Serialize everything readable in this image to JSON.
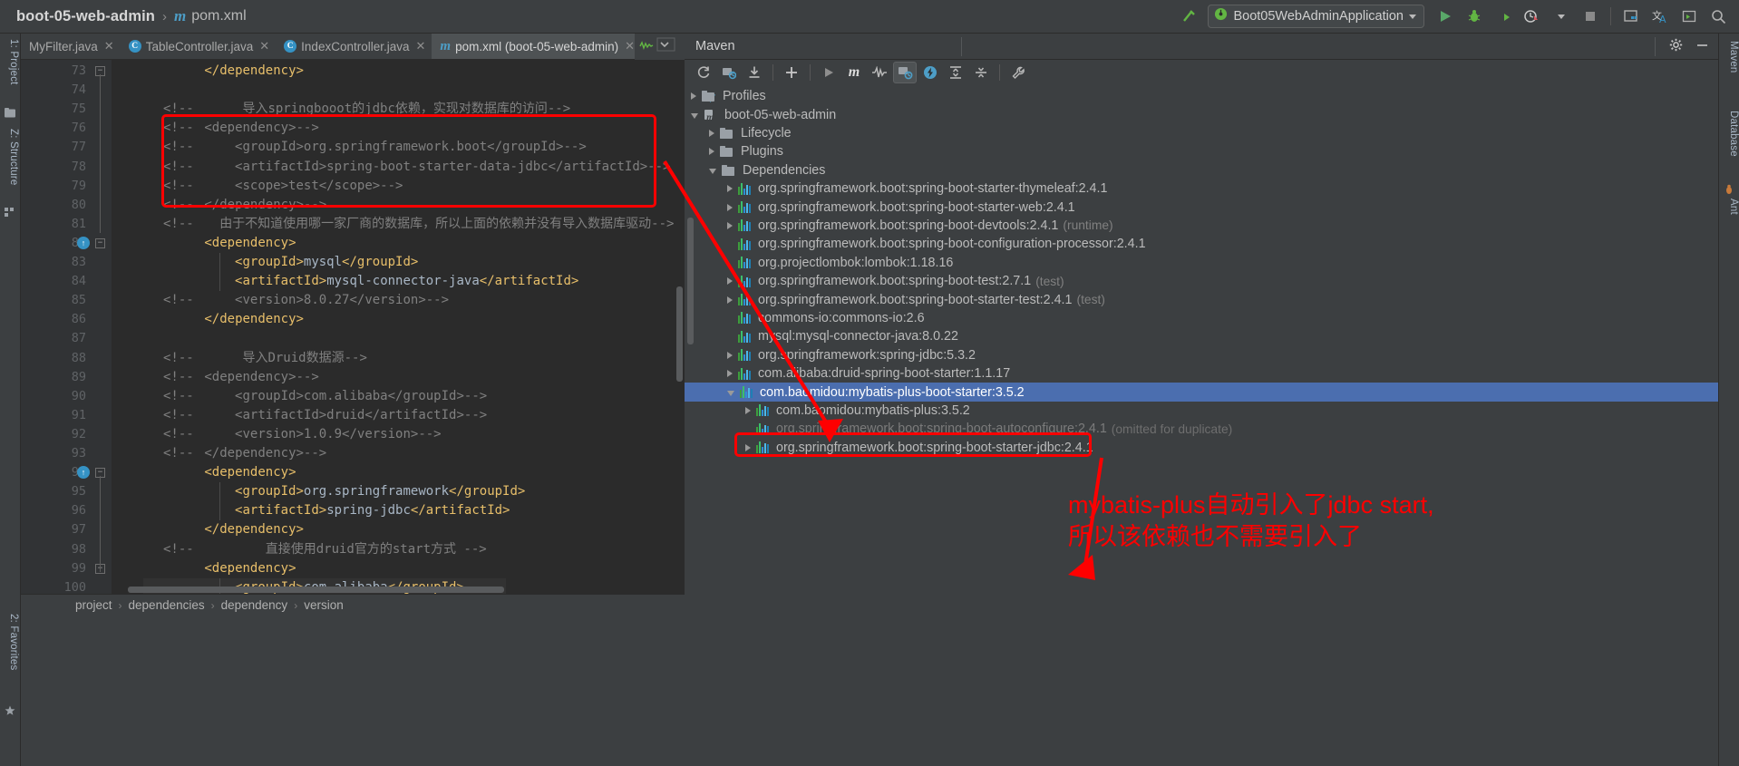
{
  "window": {
    "breadcrumb": {
      "project": "boot-05-web-admin",
      "separator": "›",
      "file": "pom.xml",
      "file_icon": "maven-m-icon"
    }
  },
  "toolbar": {
    "build_icon": "hammer-icon",
    "run_config": {
      "name": "Boot05WebAdminApplication",
      "icon": "spring-boot-icon",
      "dropdown_icon": "chevron-down-icon"
    },
    "buttons": [
      {
        "name": "run-button",
        "icon": "play-icon",
        "color": "#59a869"
      },
      {
        "name": "debug-button",
        "icon": "bug-icon",
        "color": "#62b543"
      },
      {
        "name": "run-with-coverage-button",
        "icon": "coverage-icon",
        "color": "#6cae4a"
      },
      {
        "name": "profiler-button",
        "icon": "profiler-icon",
        "color": "#cfcfcf"
      },
      {
        "name": "stop-button",
        "icon": "stop-square-icon",
        "color": "#8a8a8a"
      },
      {
        "name": "project-structure-button",
        "icon": "project-structure-icon",
        "color": "#b0b0b0"
      },
      {
        "name": "translate-button",
        "icon": "translate-icon",
        "color": "#3592c4"
      },
      {
        "name": "terminal-button",
        "icon": "terminal-icon",
        "color": "#b0b0b0"
      },
      {
        "name": "search-everywhere-button",
        "icon": "search-icon",
        "color": "#b0b0b0"
      }
    ]
  },
  "left_rail": [
    {
      "label": "1: Project",
      "icon": "project-icon"
    },
    {
      "label": "Z: Structure",
      "icon": "structure-icon"
    },
    {
      "label": "2: Favorites",
      "icon": "favorites-icon"
    }
  ],
  "right_rail": [
    {
      "label": "Maven",
      "icon": "maven-icon"
    },
    {
      "label": "Database",
      "icon": "database-icon"
    },
    {
      "label": "Ant",
      "icon": "ant-icon"
    }
  ],
  "editor_tabs": [
    {
      "label": "MyFilter.java",
      "icon": "java-class-icon",
      "active": false,
      "close_icon": "close-icon"
    },
    {
      "label": "TableController.java",
      "icon": "java-class-icon",
      "active": false,
      "close_icon": "close-icon"
    },
    {
      "label": "IndexController.java",
      "icon": "java-class-icon",
      "active": false,
      "close_icon": "close-icon"
    },
    {
      "label": "pom.xml (boot-05-web-admin)",
      "icon": "maven-m-icon",
      "active": true,
      "close_icon": "close-icon"
    }
  ],
  "editor": {
    "first_line": 73,
    "lines": [
      {
        "n": 73,
        "comment_marker": "",
        "indent": 8,
        "segments": [
          {
            "t": "</dependency>",
            "c": "tag"
          }
        ]
      },
      {
        "n": 74,
        "comment_marker": "",
        "indent": 0,
        "segments": []
      },
      {
        "n": 75,
        "comment_marker": "<!--",
        "indent": 13,
        "segments": [
          {
            "t": "导入springbooot的jdbc依赖，实现对数据库的访问-->",
            "c": "cmt"
          }
        ]
      },
      {
        "n": 76,
        "comment_marker": "<!--",
        "indent": 8,
        "segments": [
          {
            "t": "<dependency>-->",
            "c": "cmt"
          }
        ]
      },
      {
        "n": 77,
        "comment_marker": "<!--",
        "indent": 12,
        "segments": [
          {
            "t": "<groupId>org.springframework.boot</groupId>-->",
            "c": "cmt"
          }
        ]
      },
      {
        "n": 78,
        "comment_marker": "<!--",
        "indent": 12,
        "segments": [
          {
            "t": "<artifactId>spring-boot-starter-data-jdbc</artifactId>-->",
            "c": "cmt"
          }
        ]
      },
      {
        "n": 79,
        "comment_marker": "<!--",
        "indent": 12,
        "segments": [
          {
            "t": "<scope>test</scope>-->",
            "c": "cmt"
          }
        ]
      },
      {
        "n": 80,
        "comment_marker": "<!--",
        "indent": 8,
        "segments": [
          {
            "t": "</dependency>-->",
            "c": "cmt"
          }
        ]
      },
      {
        "n": 81,
        "comment_marker": "<!--",
        "indent": 10,
        "segments": [
          {
            "t": "由于不知道使用哪一家厂商的数据库，所以上面的依赖并没有导入数据库驱动-->",
            "c": "cmt"
          }
        ]
      },
      {
        "n": 82,
        "comment_marker": "",
        "indent": 8,
        "segments": [
          {
            "t": "<dependency>",
            "c": "tag"
          }
        ]
      },
      {
        "n": 83,
        "comment_marker": "",
        "indent": 12,
        "segments": [
          {
            "t": "<groupId>",
            "c": "tag"
          },
          {
            "t": "mysql",
            "c": "val"
          },
          {
            "t": "</groupId>",
            "c": "tag"
          }
        ]
      },
      {
        "n": 84,
        "comment_marker": "",
        "indent": 12,
        "segments": [
          {
            "t": "<artifactId>",
            "c": "tag"
          },
          {
            "t": "mysql-connector-java",
            "c": "val"
          },
          {
            "t": "</artifactId>",
            "c": "tag"
          }
        ]
      },
      {
        "n": 85,
        "comment_marker": "<!--",
        "indent": 12,
        "segments": [
          {
            "t": "<version>8.0.27</version>-->",
            "c": "cmt"
          }
        ]
      },
      {
        "n": 86,
        "comment_marker": "",
        "indent": 8,
        "segments": [
          {
            "t": "</dependency>",
            "c": "tag"
          }
        ]
      },
      {
        "n": 87,
        "comment_marker": "",
        "indent": 0,
        "segments": []
      },
      {
        "n": 88,
        "comment_marker": "<!--",
        "indent": 13,
        "segments": [
          {
            "t": "导入Druid数据源-->",
            "c": "cmt"
          }
        ]
      },
      {
        "n": 89,
        "comment_marker": "<!--",
        "indent": 8,
        "segments": [
          {
            "t": "<dependency>-->",
            "c": "cmt"
          }
        ]
      },
      {
        "n": 90,
        "comment_marker": "<!--",
        "indent": 12,
        "segments": [
          {
            "t": "<groupId>com.alibaba</groupId>-->",
            "c": "cmt"
          }
        ]
      },
      {
        "n": 91,
        "comment_marker": "<!--",
        "indent": 12,
        "segments": [
          {
            "t": "<artifactId>druid</artifactId>-->",
            "c": "cmt"
          }
        ]
      },
      {
        "n": 92,
        "comment_marker": "<!--",
        "indent": 12,
        "segments": [
          {
            "t": "<version>1.0.9</version>-->",
            "c": "cmt"
          }
        ]
      },
      {
        "n": 93,
        "comment_marker": "<!--",
        "indent": 8,
        "segments": [
          {
            "t": "</dependency>-->",
            "c": "cmt"
          }
        ]
      },
      {
        "n": 94,
        "comment_marker": "",
        "indent": 8,
        "segments": [
          {
            "t": "<dependency>",
            "c": "tag"
          }
        ]
      },
      {
        "n": 95,
        "comment_marker": "",
        "indent": 12,
        "segments": [
          {
            "t": "<groupId>",
            "c": "tag"
          },
          {
            "t": "org.springframework",
            "c": "val"
          },
          {
            "t": "</groupId>",
            "c": "tag"
          }
        ]
      },
      {
        "n": 96,
        "comment_marker": "",
        "indent": 12,
        "segments": [
          {
            "t": "<artifactId>",
            "c": "tag"
          },
          {
            "t": "spring-jdbc",
            "c": "val"
          },
          {
            "t": "</artifactId>",
            "c": "tag"
          }
        ]
      },
      {
        "n": 97,
        "comment_marker": "",
        "indent": 8,
        "segments": [
          {
            "t": "</dependency>",
            "c": "tag"
          }
        ]
      },
      {
        "n": 98,
        "comment_marker": "<!--",
        "indent": 16,
        "segments": [
          {
            "t": "直接使用druid官方的start方式 -->",
            "c": "cmt"
          }
        ]
      },
      {
        "n": 99,
        "comment_marker": "",
        "indent": 8,
        "segments": [
          {
            "t": "<dependency>",
            "c": "tag"
          }
        ]
      },
      {
        "n": 100,
        "comment_marker": "",
        "indent": 12,
        "segments": [
          {
            "t": "<groupId>",
            "c": "tag"
          },
          {
            "t": "com.alibaba",
            "c": "val"
          },
          {
            "t": "</groupId>",
            "c": "tag"
          }
        ]
      }
    ]
  },
  "editor_breadcrumb": {
    "items": [
      "project",
      "dependencies",
      "dependency",
      "version"
    ],
    "separator": "›"
  },
  "maven_panel": {
    "title": "Maven",
    "header_icons": [
      {
        "name": "settings-gear-icon",
        "glyph": "⚙"
      },
      {
        "name": "minimize-icon",
        "glyph": "−"
      }
    ],
    "toolbar_buttons": [
      {
        "name": "reload-all-maven-projects-button",
        "icon": "refresh-icon"
      },
      {
        "name": "generate-sources-button",
        "icon": "generate-sources-icon"
      },
      {
        "name": "download-sources-button",
        "icon": "download-icon"
      },
      {
        "name": "add-maven-project-button",
        "icon": "plus-icon"
      },
      {
        "name": "run-maven-build-button",
        "icon": "play-icon"
      },
      {
        "name": "execute-maven-goal-button",
        "icon": "maven-m-icon"
      },
      {
        "name": "toggle-skip-tests-button",
        "icon": "skip-tests-icon"
      },
      {
        "name": "toggle-offline-mode-button",
        "icon": "offline-mode-icon",
        "selected": true
      },
      {
        "name": "show-dependencies-button",
        "icon": "dependencies-lightning-icon"
      },
      {
        "name": "expand-all-button",
        "icon": "expand-all-icon"
      },
      {
        "name": "collapse-all-button",
        "icon": "collapse-all-icon"
      },
      {
        "name": "maven-settings-button",
        "icon": "wrench-icon"
      }
    ],
    "tree": [
      {
        "label": "Profiles",
        "depth": 0,
        "twist": "closed",
        "icon": "profiles-folder-icon",
        "extra": "",
        "selected": false,
        "dim": false
      },
      {
        "label": "boot-05-web-admin",
        "depth": 0,
        "twist": "open",
        "icon": "maven-project-icon",
        "extra": "",
        "selected": false,
        "dim": false
      },
      {
        "label": "Lifecycle",
        "depth": 1,
        "twist": "closed",
        "icon": "lifecycle-folder-icon",
        "extra": "",
        "selected": false,
        "dim": false
      },
      {
        "label": "Plugins",
        "depth": 1,
        "twist": "closed",
        "icon": "plugins-folder-icon",
        "extra": "",
        "selected": false,
        "dim": false
      },
      {
        "label": "Dependencies",
        "depth": 1,
        "twist": "open",
        "icon": "dependencies-folder-icon",
        "extra": "",
        "selected": false,
        "dim": false
      },
      {
        "label": "org.springframework.boot:spring-boot-starter-thymeleaf:2.4.1",
        "depth": 2,
        "twist": "closed",
        "icon": "jar-icon",
        "extra": "",
        "selected": false,
        "dim": false
      },
      {
        "label": "org.springframework.boot:spring-boot-starter-web:2.4.1",
        "depth": 2,
        "twist": "closed",
        "icon": "jar-icon",
        "extra": "",
        "selected": false,
        "dim": false
      },
      {
        "label": "org.springframework.boot:spring-boot-devtools:2.4.1",
        "depth": 2,
        "twist": "closed",
        "icon": "jar-icon",
        "extra": "(runtime)",
        "selected": false,
        "dim": false
      },
      {
        "label": "org.springframework.boot:spring-boot-configuration-processor:2.4.1",
        "depth": 2,
        "twist": "none",
        "icon": "jar-icon",
        "extra": "",
        "selected": false,
        "dim": false
      },
      {
        "label": "org.projectlombok:lombok:1.18.16",
        "depth": 2,
        "twist": "none",
        "icon": "jar-icon",
        "extra": "",
        "selected": false,
        "dim": false
      },
      {
        "label": "org.springframework.boot:spring-boot-test:2.7.1",
        "depth": 2,
        "twist": "closed",
        "icon": "jar-icon",
        "extra": "(test)",
        "selected": false,
        "dim": false
      },
      {
        "label": "org.springframework.boot:spring-boot-starter-test:2.4.1",
        "depth": 2,
        "twist": "closed",
        "icon": "jar-icon",
        "extra": "(test)",
        "selected": false,
        "dim": false
      },
      {
        "label": "commons-io:commons-io:2.6",
        "depth": 2,
        "twist": "none",
        "icon": "jar-icon",
        "extra": "",
        "selected": false,
        "dim": false
      },
      {
        "label": "mysql:mysql-connector-java:8.0.22",
        "depth": 2,
        "twist": "none",
        "icon": "jar-icon",
        "extra": "",
        "selected": false,
        "dim": false
      },
      {
        "label": "org.springframework:spring-jdbc:5.3.2",
        "depth": 2,
        "twist": "closed",
        "icon": "jar-icon",
        "extra": "",
        "selected": false,
        "dim": false
      },
      {
        "label": "com.alibaba:druid-spring-boot-starter:1.1.17",
        "depth": 2,
        "twist": "closed",
        "icon": "jar-icon",
        "extra": "",
        "selected": false,
        "dim": false
      },
      {
        "label": "com.baomidou:mybatis-plus-boot-starter:3.5.2",
        "depth": 2,
        "twist": "open",
        "icon": "jar-icon",
        "extra": "",
        "selected": true,
        "dim": false
      },
      {
        "label": "com.baomidou:mybatis-plus:3.5.2",
        "depth": 3,
        "twist": "closed",
        "icon": "jar-icon",
        "extra": "",
        "selected": false,
        "dim": false
      },
      {
        "label": "org.springframework.boot:spring-boot-autoconfigure:2.4.1",
        "depth": 3,
        "twist": "none",
        "icon": "jar-icon",
        "extra": "(omitted for duplicate)",
        "selected": false,
        "dim": true
      },
      {
        "label": "org.springframework.boot:spring-boot-starter-jdbc:2.4.1",
        "depth": 3,
        "twist": "closed",
        "icon": "jar-icon",
        "extra": "",
        "selected": false,
        "dim": false
      }
    ]
  },
  "annotations": {
    "rectangle_1": {
      "name": "highlight-rect-commented-jdbc-dependency",
      "color": "#fe0000"
    },
    "rectangle_2": {
      "name": "highlight-rect-starter-jdbc-tree-node",
      "color": "#fe0000"
    },
    "arrow_1": {
      "name": "arrow-code-to-tree",
      "color": "#fe0000"
    },
    "arrow_2": {
      "name": "arrow-note-to-tree",
      "color": "#fe0000"
    },
    "note_text": "mybatis-plus自动引入了jdbc start,所以该依赖也不需要引入了",
    "note_color": "#fe0000"
  },
  "colors": {
    "background": "#3c3f41",
    "editor_background": "#2b2b2b",
    "gutter": "#313335",
    "selection_blue": "#4b6eaf",
    "tag_orange": "#e8bf6a",
    "value_blue": "#a9b7c6",
    "comment_gray": "#808080",
    "accent_red": "#fe0000"
  }
}
